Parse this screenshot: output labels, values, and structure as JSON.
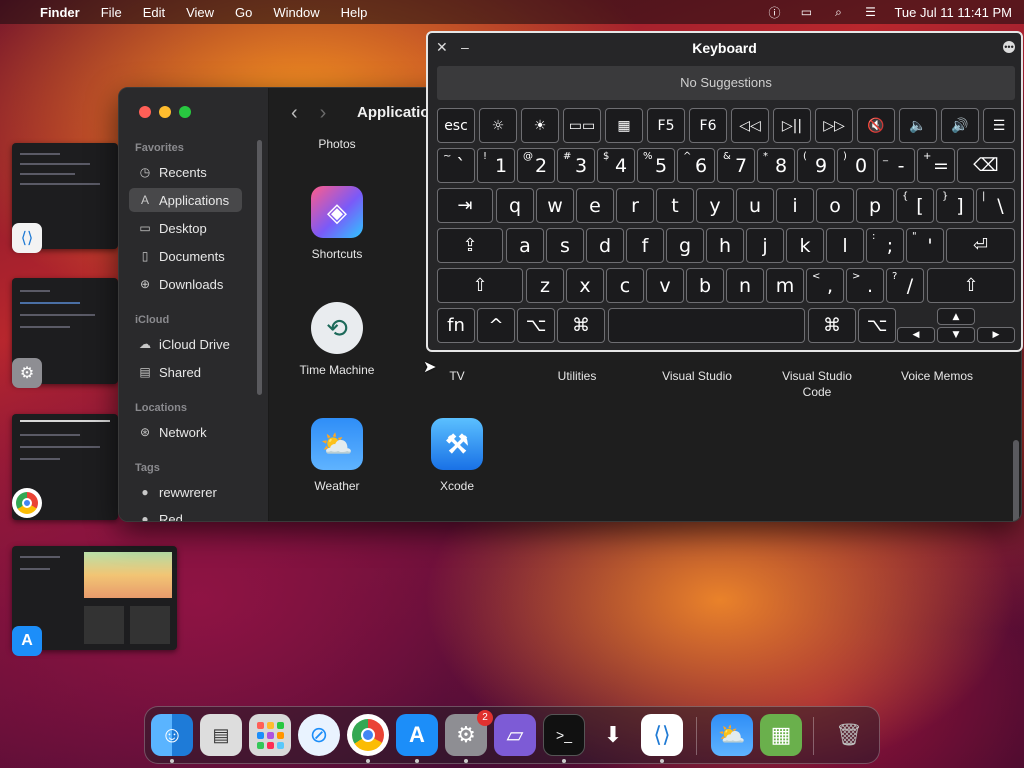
{
  "menubar": {
    "app_name": "Finder",
    "menus": [
      "File",
      "Edit",
      "View",
      "Go",
      "Window",
      "Help"
    ],
    "clock": "Tue Jul 11  11:41 PM"
  },
  "finder": {
    "title": "Applicatio",
    "sidebar": {
      "favorites_header": "Favorites",
      "favorites": [
        "Recents",
        "Applications",
        "Desktop",
        "Documents",
        "Downloads"
      ],
      "icloud_header": "iCloud",
      "icloud": [
        "iCloud Drive",
        "Shared"
      ],
      "locations_header": "Locations",
      "locations": [
        "Network"
      ],
      "tags_header": "Tags",
      "tags": [
        "rewwrerer",
        "Red"
      ]
    },
    "apps": {
      "photos": "Photos",
      "shortcuts": "Shortcuts",
      "time_machine": "Time Machine",
      "tv": "TV",
      "utilities": "Utilities",
      "visual_studio": "Visual Studio",
      "vs_code_line1": "Visual Studio",
      "vs_code_line2": "Code",
      "voice_memos": "Voice Memos",
      "weather": "Weather",
      "xcode": "Xcode"
    }
  },
  "keyboard": {
    "title": "Keyboard",
    "suggestions": "No Suggestions",
    "fn_row": [
      "esc",
      "☼",
      "☀",
      "▭▭",
      "▦",
      "F5",
      "F6",
      "◁◁",
      "▷||",
      "▷▷",
      "🔇",
      "🔈",
      "🔊",
      "☰"
    ],
    "number_row": [
      {
        "sub": "~",
        "main": "`"
      },
      {
        "sub": "!",
        "main": "1"
      },
      {
        "sub": "@",
        "main": "2"
      },
      {
        "sub": "#",
        "main": "3"
      },
      {
        "sub": "$",
        "main": "4"
      },
      {
        "sub": "%",
        "main": "5"
      },
      {
        "sub": "^",
        "main": "6"
      },
      {
        "sub": "&",
        "main": "7"
      },
      {
        "sub": "*",
        "main": "8"
      },
      {
        "sub": "(",
        "main": "9"
      },
      {
        "sub": ")",
        "main": "0"
      },
      {
        "sub": "_",
        "main": "-"
      },
      {
        "sub": "+",
        "main": "="
      }
    ],
    "row_q": [
      "q",
      "w",
      "e",
      "r",
      "t",
      "y",
      "u",
      "i",
      "o",
      "p"
    ],
    "row_q_brackets": [
      {
        "sub": "{",
        "main": "["
      },
      {
        "sub": "}",
        "main": "]"
      },
      {
        "sub": "|",
        "main": "\\"
      }
    ],
    "row_a": [
      "a",
      "s",
      "d",
      "f",
      "g",
      "h",
      "j",
      "k",
      "l"
    ],
    "row_a_punct": [
      {
        "sub": ":",
        "main": ";"
      },
      {
        "sub": "\"",
        "main": "'"
      }
    ],
    "row_z": [
      "z",
      "x",
      "c",
      "v",
      "b",
      "n",
      "m"
    ],
    "row_z_punct": [
      {
        "sub": "<",
        "main": ","
      },
      {
        "sub": ">",
        "main": "."
      },
      {
        "sub": "?",
        "main": "/"
      }
    ],
    "fn_label": "fn"
  },
  "colors": {
    "close": "#ff5f57",
    "minimize": "#febc2e",
    "zoom": "#28c840"
  }
}
